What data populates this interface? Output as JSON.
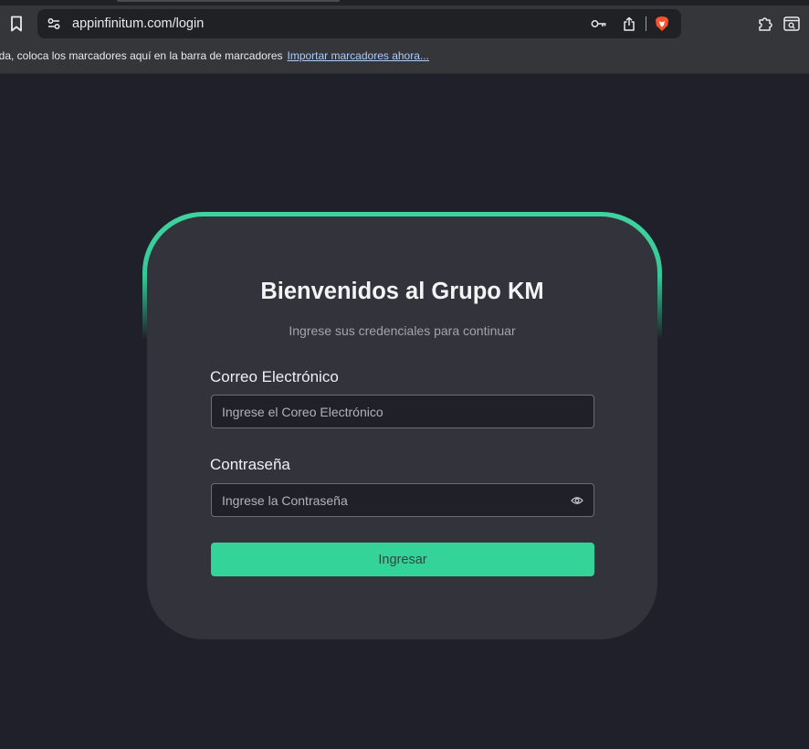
{
  "browser": {
    "url": "appinfinitum.com/login",
    "bookmarks_bar_hint": "ida, coloca los marcadores aquí en la barra de marcadores",
    "import_bookmarks_link": "Importar marcadores ahora...",
    "icons": [
      "bookmark-icon",
      "site-settings-icon",
      "key-icon",
      "share-icon",
      "brave-shields-icon",
      "extensions-icon",
      "reader-mode-icon"
    ]
  },
  "login": {
    "title": "Bienvenidos al Grupo KM",
    "subtitle": "Ingrese sus credenciales para continuar",
    "email_label": "Correo Electrónico",
    "email_placeholder": "Ingrese el Coreo Electrónico",
    "email_value": "",
    "password_label": "Contraseña",
    "password_placeholder": "Ingrese la Contraseña",
    "password_value": "",
    "submit_label": "Ingresar"
  },
  "colors": {
    "page_background": "#1f2029",
    "card_background": "#32333b",
    "accent": "#34d399",
    "input_background": "#1f2028"
  }
}
